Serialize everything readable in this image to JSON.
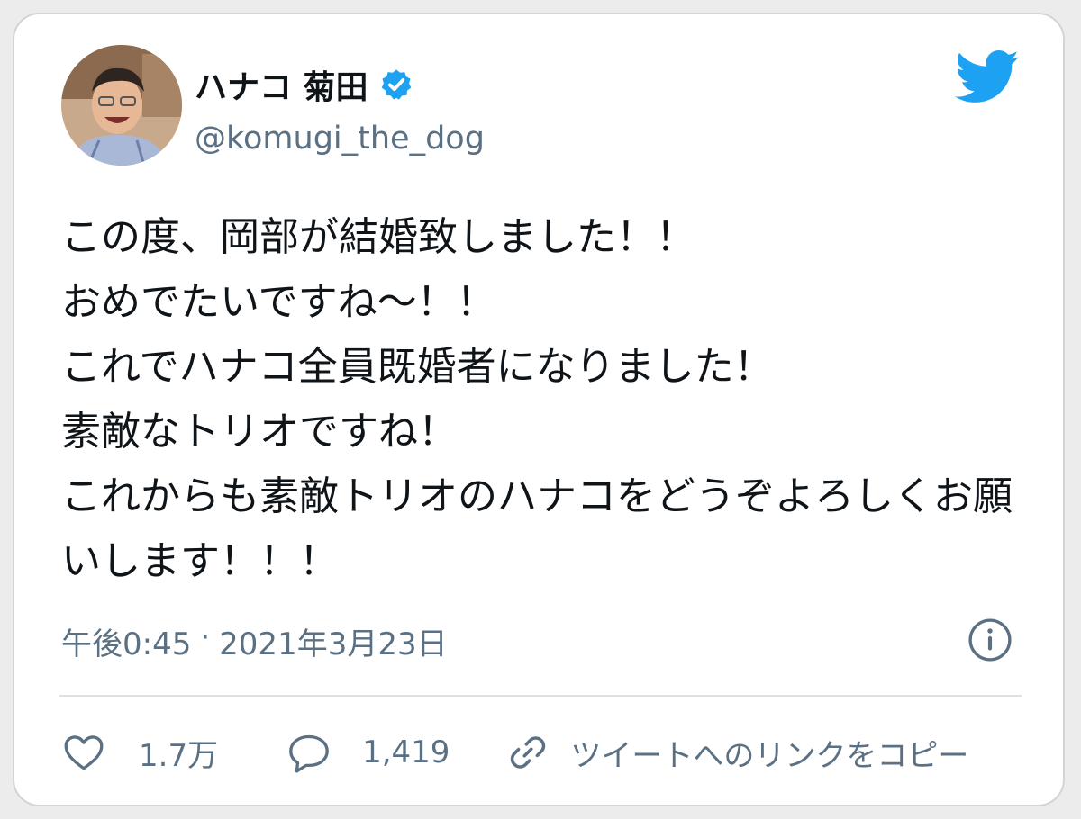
{
  "user": {
    "display_name": "ハナコ 菊田",
    "handle": "@komugi_the_dog",
    "verified": true
  },
  "tweet": {
    "lines": [
      "この度、岡部が結婚致しました！！",
      "おめでたいですね〜！！",
      "これでハナコ全員既婚者になりました！",
      "素敵なトリオですね！",
      "これからも素敵トリオのハナコをどうぞよろしくお願",
      "いします！！！"
    ],
    "time": "午後0:45",
    "separator": "·",
    "date": "2021年3月23日"
  },
  "actions": {
    "likes": "1.7万",
    "replies": "1,419",
    "copy_link": "ツイートへのリンクをコピー"
  },
  "icons": {
    "avatar": "user-avatar",
    "verified": "verified-badge-icon",
    "logo": "twitter-bird-icon",
    "info": "info-icon",
    "like": "heart-icon",
    "reply": "speech-bubble-icon",
    "link": "link-icon"
  },
  "colors": {
    "twitter_blue": "#1da1f2",
    "text_primary": "#0f1419",
    "text_secondary": "#5b7083"
  }
}
